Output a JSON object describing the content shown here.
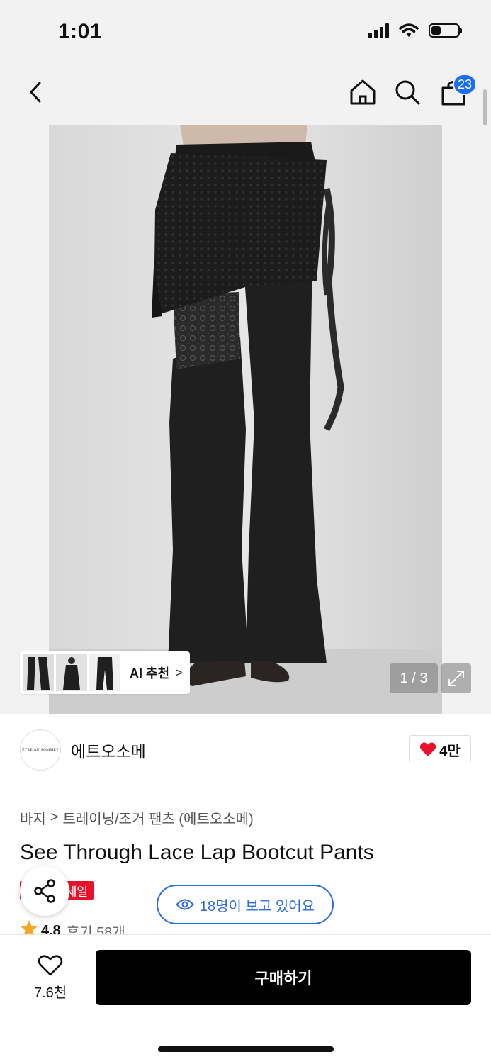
{
  "status_bar": {
    "time": "1:01",
    "battery_level": 0.35,
    "icons": [
      "signal-icon",
      "wifi-icon",
      "battery-icon"
    ]
  },
  "nav": {
    "icons": [
      "back-chevron-icon",
      "home-icon",
      "search-icon",
      "cart-icon"
    ],
    "cart_count": "23"
  },
  "gallery": {
    "ai_recommend_label": "AI 추천",
    "ai_recommend_chevron": ">",
    "page_counter": "1 / 3"
  },
  "brand": {
    "logo_text": "ÊTRE AU SOMMET",
    "name": "에트오소메",
    "likes": "4만"
  },
  "product": {
    "breadcrumb": [
      "바지",
      "트레이닝/조거 팬츠 (에트오소메)"
    ],
    "breadcrumb_separator": ">",
    "title": "See Through Lace Lap Bootcut Pants",
    "sale_badge": "세일",
    "viewers": "18명이 보고 있어요",
    "rating": "4.8",
    "reviews": "후기 58개"
  },
  "bottom_bar": {
    "wish_count": "7.6천",
    "buy_label": "구매하기"
  },
  "colors": {
    "accent_blue": "#2d6ce0",
    "badge_blue": "#1a6ef5",
    "sale_red": "#e8132a",
    "heart_red": "#e8132a",
    "star_orange": "#f5a623",
    "buy_black": "#000000"
  }
}
